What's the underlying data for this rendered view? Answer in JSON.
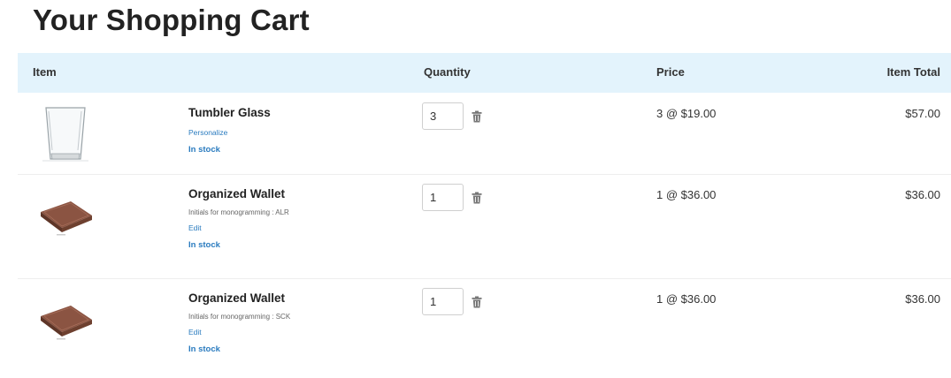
{
  "page": {
    "title": "Your Shopping Cart"
  },
  "cart": {
    "columns": {
      "item": "Item",
      "quantity": "Quantity",
      "price": "Price",
      "item_total": "Item Total"
    },
    "items": [
      {
        "name": "Tumbler Glass",
        "link": "Personalize",
        "stock": "In stock",
        "quantity": "3",
        "price": "3 @ $19.00",
        "total": "$57.00",
        "thumbnail_icon": "tumbler-glass-image"
      },
      {
        "name": "Organized Wallet",
        "detail": "Initials for monogramming : ALR",
        "link": "Edit",
        "stock": "In stock",
        "quantity": "1",
        "price": "1 @ $36.00",
        "total": "$36.00",
        "thumbnail_icon": "wallet-image"
      },
      {
        "name": "Organized Wallet",
        "detail": "Initials for monogramming : SCK",
        "link": "Edit",
        "stock": "In stock",
        "quantity": "1",
        "price": "1 @ $36.00",
        "total": "$36.00",
        "thumbnail_icon": "wallet-image"
      }
    ]
  },
  "colors": {
    "header_bg": "#e3f3fc",
    "link": "#2a7bbf",
    "wallet": "#8b5442"
  },
  "icons": {
    "remove": "trash-icon"
  }
}
